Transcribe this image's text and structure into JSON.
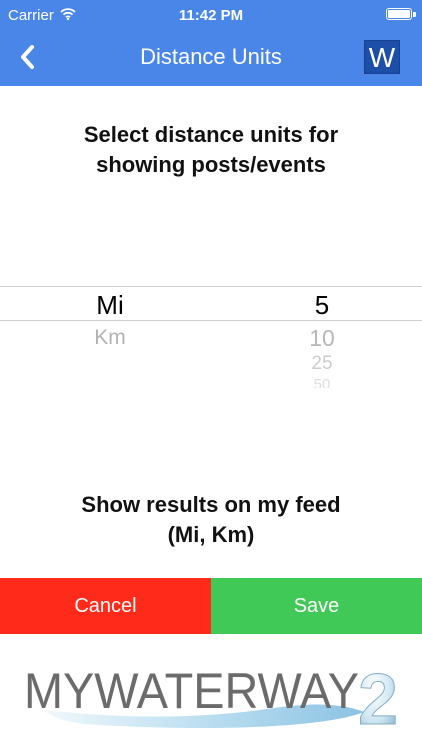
{
  "status_bar": {
    "carrier": "Carrier",
    "time": "11:42 PM",
    "wifi_icon": "wifi-icon",
    "battery_icon": "battery-icon",
    "battery_level": 1.0
  },
  "nav": {
    "title": "Distance Units",
    "back_icon": "chevron-left-icon",
    "w_label": "W",
    "color": "#4a86e8"
  },
  "prompt": {
    "line1": "Select distance units for",
    "line2": "showing posts/events"
  },
  "picker": {
    "units": {
      "options": [
        "Mi",
        "Km"
      ],
      "selected": "Mi"
    },
    "distances": {
      "options": [
        "5",
        "10",
        "25",
        "50"
      ],
      "selected": "5"
    }
  },
  "feed_note": {
    "line1": "Show results on my feed",
    "line2": "(Mi, Km)"
  },
  "buttons": {
    "cancel": "Cancel",
    "save": "Save",
    "cancel_color": "#ff2a1a",
    "save_color": "#41c958"
  },
  "logo": {
    "text": "MYWATERWAY",
    "mark": "2"
  }
}
